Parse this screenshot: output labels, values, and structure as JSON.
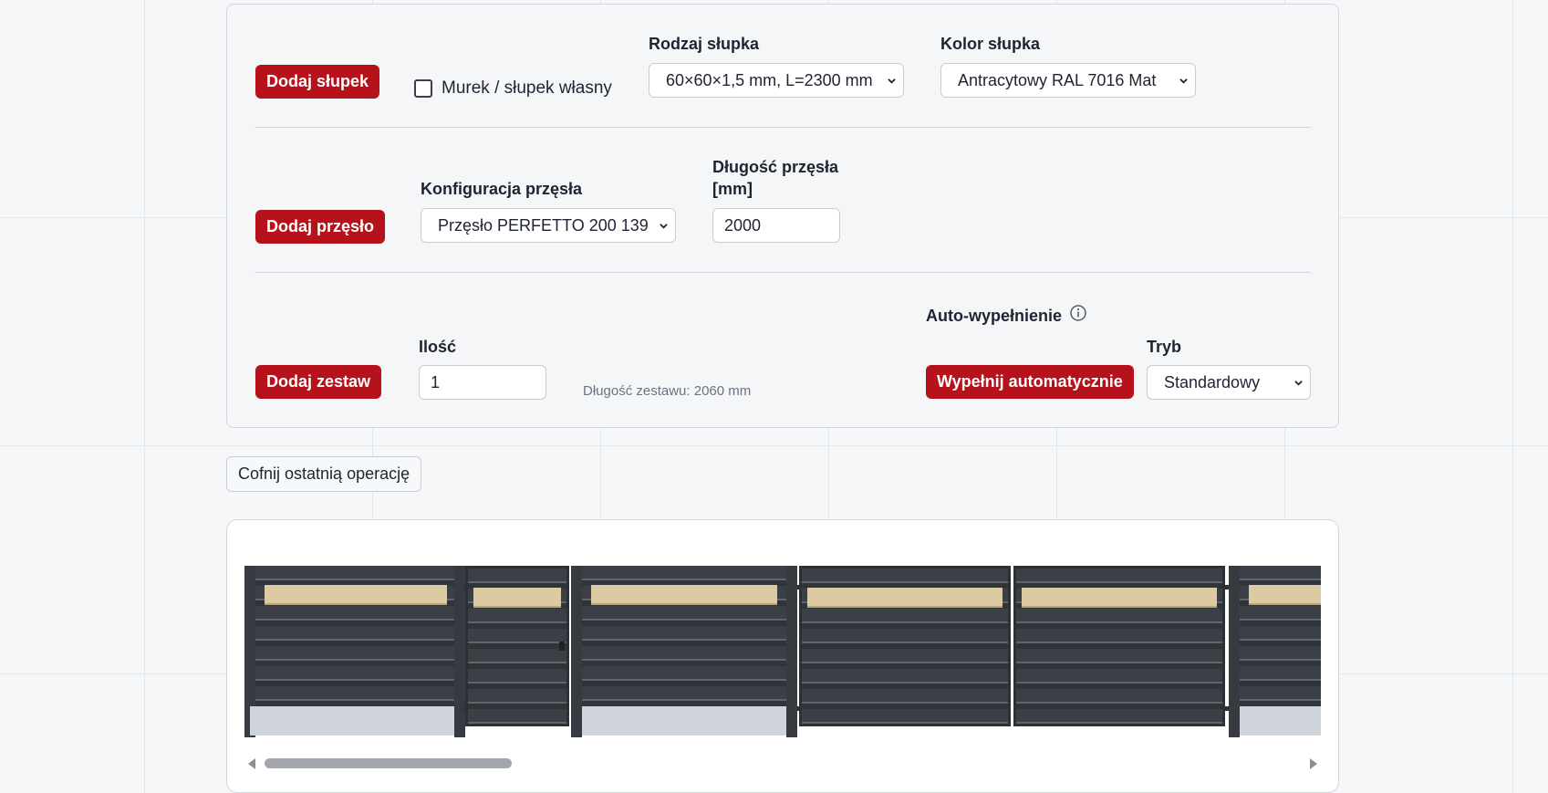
{
  "posts_row": {
    "add_post_label": "Dodaj słupek",
    "own_post_checkbox_label": "Murek / słupek własny",
    "post_type_label": "Rodzaj słupka",
    "post_type_value": "60×60×1,5 mm, L=2300 mm",
    "post_color_label": "Kolor słupka",
    "post_color_value": "Antracytowy RAL 7016 Mat"
  },
  "span_row": {
    "add_span_label": "Dodaj przęsło",
    "span_config_label": "Konfiguracja przęsła",
    "span_config_value": "Przęsło PERFETTO 200 139",
    "span_length_label_line1": "Długość przęsła",
    "span_length_label_line2": "[mm]",
    "span_length_value": "2000"
  },
  "set_row": {
    "add_set_label": "Dodaj zestaw",
    "quantity_label": "Ilość",
    "quantity_value": "1",
    "set_length_text": "Długość zestawu: 2060 mm",
    "autofill_label": "Auto-wypełnienie",
    "autofill_button_label": "Wypełnij automatycznie",
    "mode_label": "Tryb",
    "mode_value": "Standardowy"
  },
  "undo_label": "Cofnij ostatnią operację",
  "colors": {
    "accent": "#b5121b",
    "fence_dark": "#353b40",
    "fence_accent_strip": "#dccba2",
    "wall": "#cfd3dc"
  },
  "icons": {
    "info": "info-circle-icon",
    "chevron": "chevron-down-icon"
  }
}
